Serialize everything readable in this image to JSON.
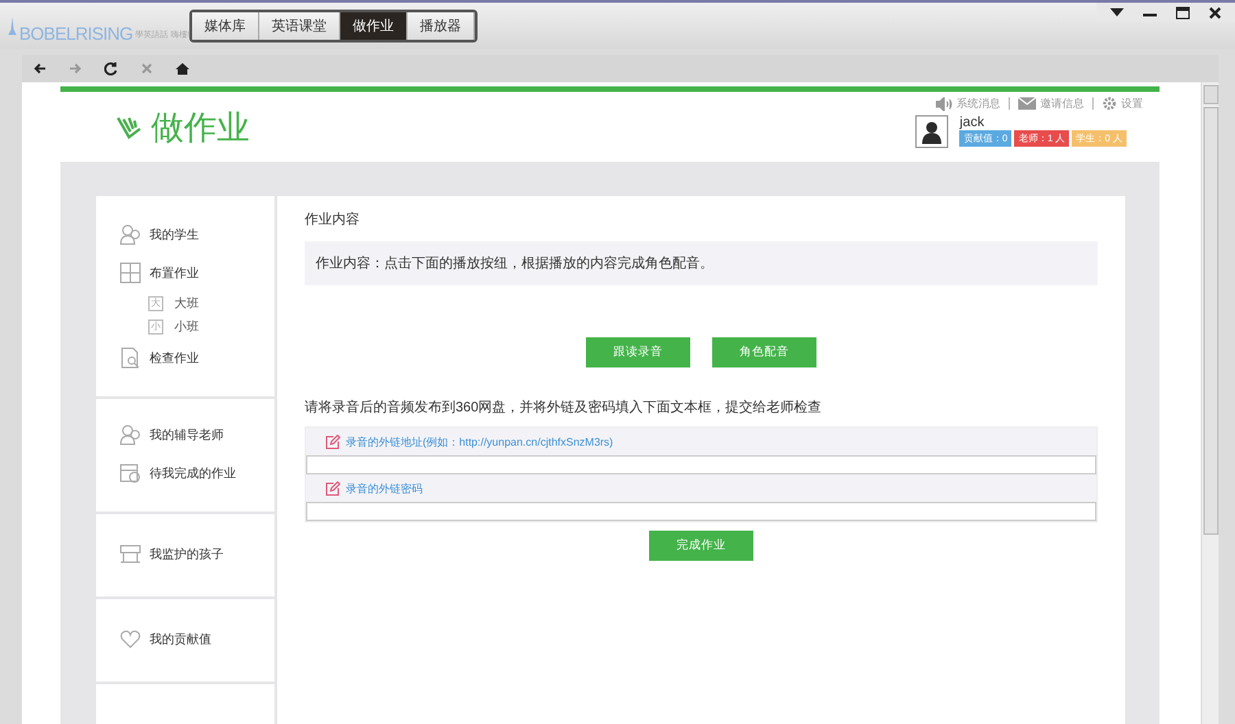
{
  "app": {
    "logo": "BOBELRISING",
    "tagline": "學英語話 嗨樓!"
  },
  "tabs": [
    {
      "label": "媒体库",
      "selected": false
    },
    {
      "label": "英语课堂",
      "selected": false
    },
    {
      "label": "做作业",
      "selected": true
    },
    {
      "label": "播放器",
      "selected": false
    }
  ],
  "nav_buttons": [
    {
      "kind": "back",
      "disabled": false
    },
    {
      "kind": "forward",
      "disabled": true
    },
    {
      "kind": "refresh",
      "disabled": false
    },
    {
      "kind": "stop",
      "disabled": true
    },
    {
      "kind": "home",
      "disabled": false
    }
  ],
  "page_title": "做作业",
  "header_links": [
    {
      "kind": "speaker",
      "label": "系统消息"
    },
    {
      "kind": "mail",
      "label": "邀请信息"
    },
    {
      "kind": "gear",
      "label": "设置"
    }
  ],
  "user": {
    "name": "jack",
    "badges": [
      {
        "label": "贡献值：0",
        "color": "#5aa9e0"
      },
      {
        "label": "老师：1 人",
        "color": "#e84c4c"
      },
      {
        "label": "学生：0 人",
        "color": "#f5c06b"
      }
    ]
  },
  "sidebar": {
    "groups": [
      {
        "items": [
          {
            "kind": "students",
            "label": "我的学生"
          },
          {
            "kind": "assign",
            "label": "布置作业",
            "children": [
              {
                "icon_char": "大",
                "label": "大班"
              },
              {
                "icon_char": "小",
                "label": "小班"
              }
            ]
          },
          {
            "kind": "check",
            "label": "检查作业"
          }
        ]
      },
      {
        "items": [
          {
            "kind": "tutor",
            "label": "我的辅导老师"
          },
          {
            "kind": "todo",
            "label": "待我完成的作业"
          }
        ]
      },
      {
        "items": [
          {
            "kind": "child",
            "label": "我监护的孩子"
          }
        ]
      },
      {
        "items": [
          {
            "kind": "heart",
            "label": "我的贡献值"
          }
        ]
      }
    ]
  },
  "main": {
    "section_title": "作业内容",
    "content": "作业内容：点击下面的播放按纽，根据播放的内容完成角色配音。",
    "action_buttons": [
      "跟读录音",
      "角色配音"
    ],
    "instruction": "请将录音后的音频发布到360网盘，并将外链及密码填入下面文本框，提交给老师检查",
    "fields": [
      {
        "label": "录音的外链地址(例如：http://yunpan.cn/cjthfxSnzM3rs)"
      },
      {
        "label": "录音的外链密码"
      }
    ],
    "submit": "完成作业"
  }
}
